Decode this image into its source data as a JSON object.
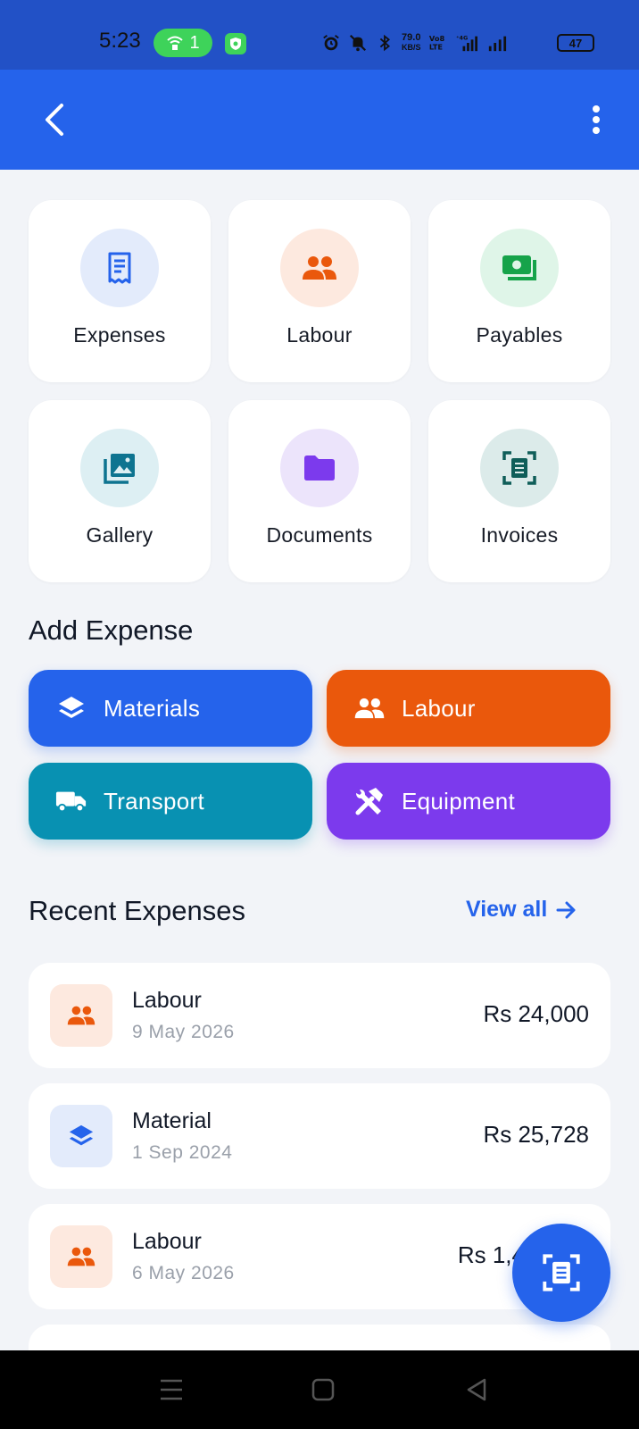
{
  "status_bar": {
    "time": "5:23",
    "hotspot_count": "1",
    "net_speed_value": "79.0",
    "net_speed_unit": "KB/S",
    "battery": "47"
  },
  "app_bar": {
    "back_icon": "chevron-left-icon",
    "menu_icon": "more-vertical-icon"
  },
  "tiles": [
    {
      "label": "Expenses",
      "icon": "receipt-icon",
      "bg": "#e3ebfb",
      "fg": "#2563eb"
    },
    {
      "label": "Labour",
      "icon": "people-icon",
      "bg": "#fde9df",
      "fg": "#ea580c"
    },
    {
      "label": "Payables",
      "icon": "cash-icon",
      "bg": "#dff5e8",
      "fg": "#16a34a"
    },
    {
      "label": "Gallery",
      "icon": "gallery-icon",
      "bg": "#ddeff3",
      "fg": "#0e7490"
    },
    {
      "label": "Documents",
      "icon": "folder-icon",
      "bg": "#ece4fb",
      "fg": "#7c3aed"
    },
    {
      "label": "Invoices",
      "icon": "scan-document-icon",
      "bg": "#dcebea",
      "fg": "#0f5e59"
    }
  ],
  "add_expense": {
    "title": "Add Expense",
    "buttons": [
      {
        "label": "Materials",
        "icon": "layers-icon",
        "color": "#2563eb"
      },
      {
        "label": "Labour",
        "icon": "people-icon",
        "color": "#ea580c"
      },
      {
        "label": "Transport",
        "icon": "truck-icon",
        "color": "#0891b2"
      },
      {
        "label": "Equipment",
        "icon": "tools-icon",
        "color": "#7c3aed"
      }
    ]
  },
  "recent": {
    "title": "Recent Expenses",
    "view_all": "View all",
    "items": [
      {
        "title": "Labour",
        "date": "9 May 2026",
        "amount": "Rs 24,000",
        "icon": "people-icon",
        "bg": "#fde9df",
        "fg": "#ea580c"
      },
      {
        "title": "Material",
        "date": "1 Sep 2024",
        "amount": "Rs 25,728",
        "icon": "layers-icon",
        "bg": "#e3ebfb",
        "fg": "#2563eb"
      },
      {
        "title": "Labour",
        "date": "6 May 2026",
        "amount": "Rs 1,4",
        "icon": "people-icon",
        "bg": "#fde9df",
        "fg": "#ea580c"
      }
    ]
  },
  "fab": {
    "icon": "scan-document-icon"
  }
}
